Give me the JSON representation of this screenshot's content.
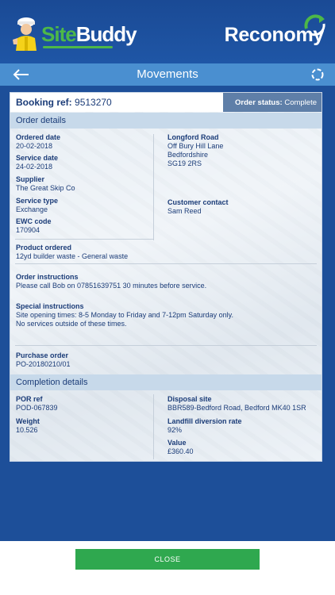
{
  "header": {
    "sitebuddy_site": "Site",
    "sitebuddy_buddy": "Buddy",
    "reconomy": "Reconomy"
  },
  "nav": {
    "title": "Movements",
    "back_icon": "arrow-left-icon",
    "refresh_icon": "refresh-icon"
  },
  "booking": {
    "ref_label": "Booking ref:",
    "ref_value": "9513270",
    "status_label": "Order status:",
    "status_value": "Complete"
  },
  "order_details": {
    "section_title": "Order details",
    "ordered_date_label": "Ordered date",
    "ordered_date": "20-02-2018",
    "service_date_label": "Service date",
    "service_date": "24-02-2018",
    "supplier_label": "Supplier",
    "supplier": "The Great Skip Co",
    "service_type_label": "Service type",
    "service_type": "Exchange",
    "ewc_label": "EWC code",
    "ewc": "170904",
    "product_label": "Product ordered",
    "product": "12yd builder waste - General waste",
    "address_title": "Longford Road",
    "address_lines": [
      "Off Bury Hill Lane",
      "Bedfordshire",
      "SG19 2RS"
    ],
    "contact_label": "Customer contact",
    "contact": "Sam Reed",
    "instructions_label": "Order instructions",
    "instructions": "Please call Bob on 07851639751 30 minutes before service.",
    "special_label": "Special instructions",
    "special_lines": [
      "Site opening times: 8-5 Monday to Friday and 7-12pm Saturday only.",
      "No services outside of these times."
    ],
    "po_label": "Purchase order",
    "po": "PO-20180210/01"
  },
  "completion_details": {
    "section_title": "Completion details",
    "por_label": "POR ref",
    "por": "POD-067839",
    "weight_label": "Weight",
    "weight": "10.526",
    "disposal_label": "Disposal site",
    "disposal": "BBR589-Bedford Road, Bedford MK40 1SR",
    "landfill_label": "Landfill diversion rate",
    "landfill": "92%",
    "value_label": "Value",
    "value": "£360.40"
  },
  "footer": {
    "close_label": "CLOSE"
  },
  "colors": {
    "brand_blue": "#1d4f99",
    "nav_blue": "#4a8fd0",
    "section_header": "#c7d9ea",
    "status_bg": "#5f7fa8",
    "close_green": "#2fa84f",
    "sitebuddy_green": "#4db848"
  }
}
